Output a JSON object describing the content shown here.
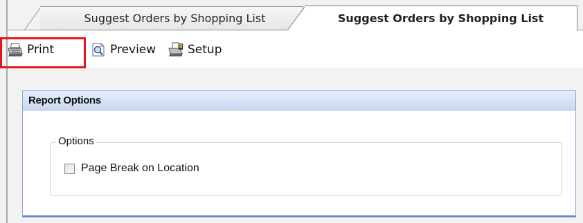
{
  "tabs": [
    {
      "label": "Suggest Orders by Shopping List",
      "active": false
    },
    {
      "label": "Suggest Orders by Shopping List",
      "active": true
    }
  ],
  "toolbar": {
    "print_label": "Print",
    "preview_label": "Preview",
    "setup_label": "Setup",
    "print_icon": "printer-icon",
    "preview_icon": "preview-icon",
    "setup_icon": "printer-setup-icon"
  },
  "report_options": {
    "title": "Report Options",
    "group_title": "Options",
    "checkbox_label": "Page Break on Location",
    "checkbox_checked": false
  },
  "colors": {
    "highlight": "#e3141b",
    "panel_accent": "#5b86c5"
  }
}
